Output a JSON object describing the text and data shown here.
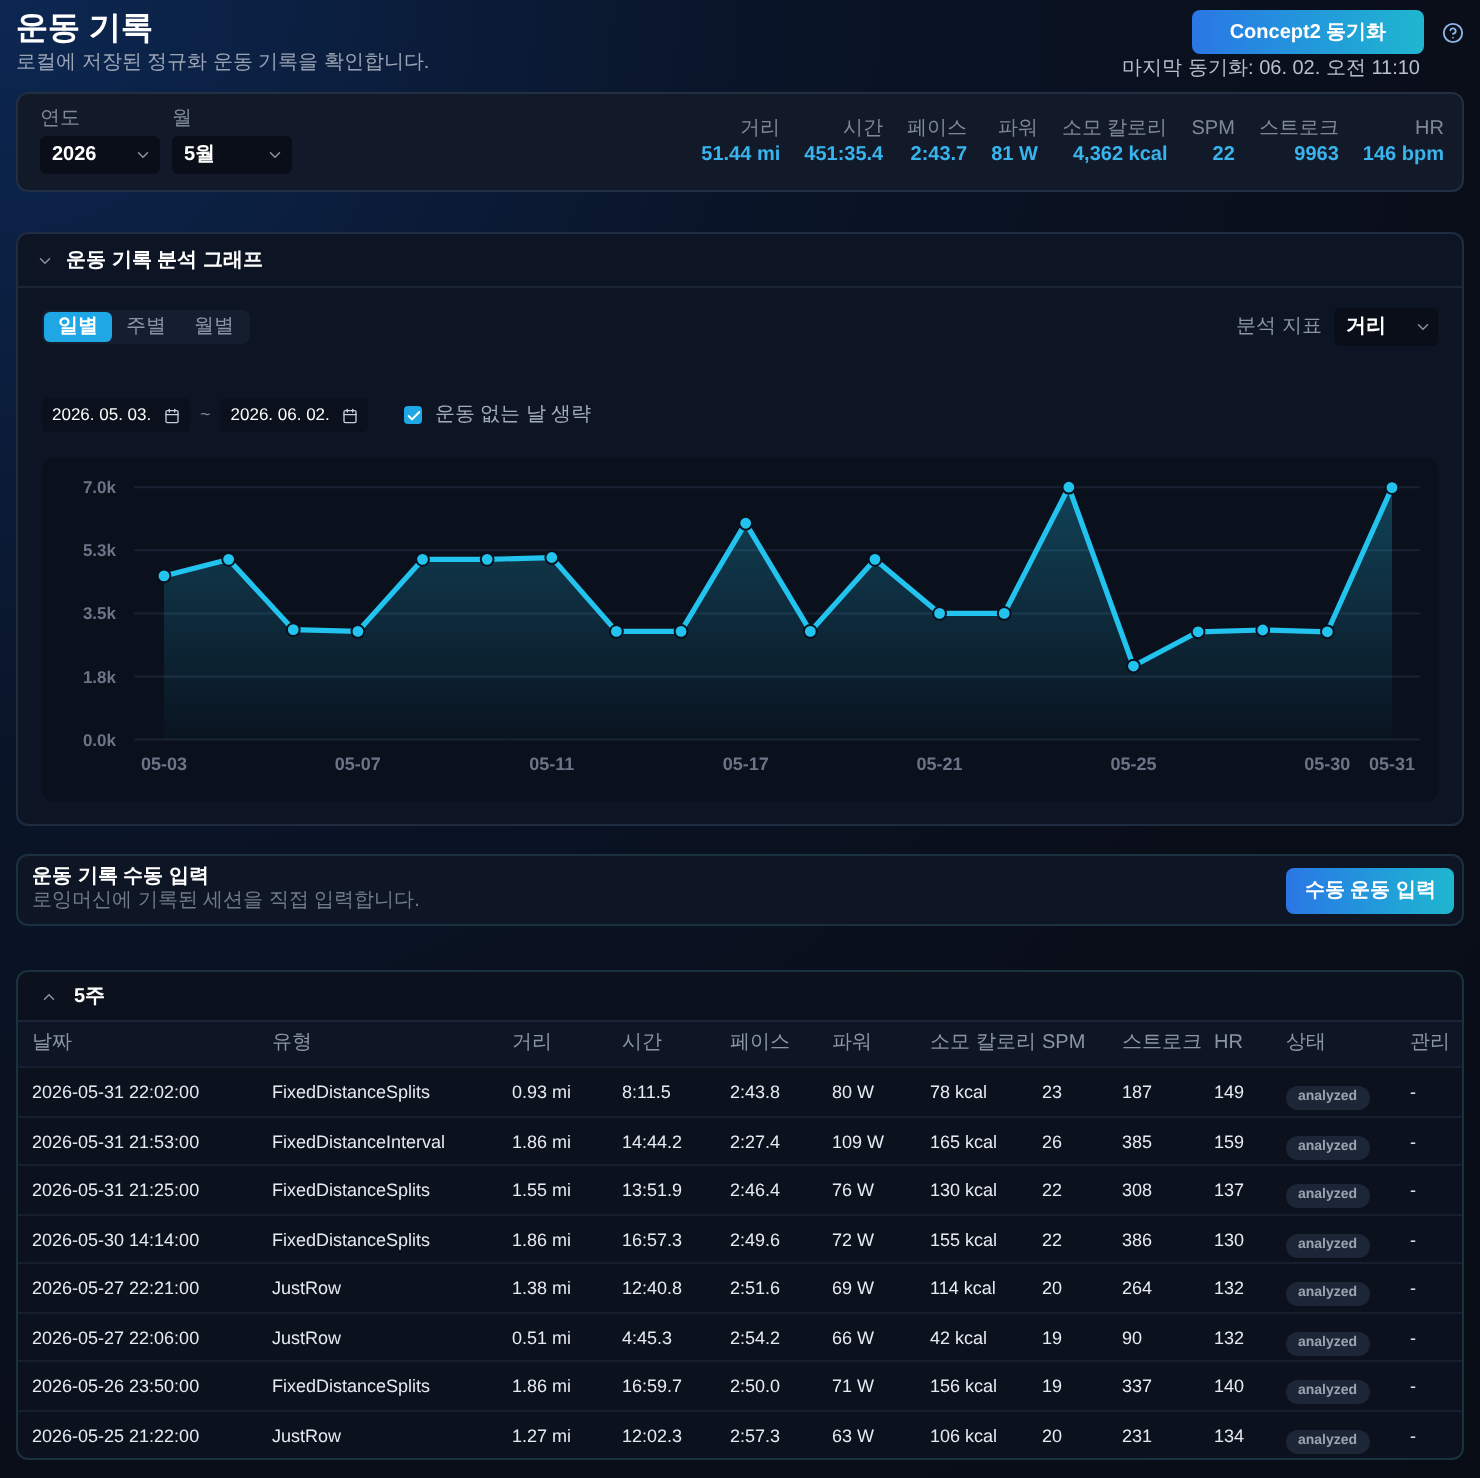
{
  "header": {
    "title": "운동 기록",
    "subtitle": "로컬에 저장된 정규화 운동 기록을 확인합니다.",
    "sync_button": "Concept2 동기화",
    "last_sync": "마지막 동기화: 06. 02. 오전 11:10"
  },
  "filters": {
    "fields": [
      {
        "label": "연도",
        "value": "2026"
      },
      {
        "label": "월",
        "value": "5월"
      }
    ],
    "stats": [
      {
        "label": "거리",
        "value": "51.44 mi"
      },
      {
        "label": "시간",
        "value": "451:35.4"
      },
      {
        "label": "페이스",
        "value": "2:43.7"
      },
      {
        "label": "파워",
        "value": "81 W"
      },
      {
        "label": "소모 칼로리",
        "value": "4,362 kcal"
      },
      {
        "label": "SPM",
        "value": "22"
      },
      {
        "label": "스트로크",
        "value": "9963"
      },
      {
        "label": "HR",
        "value": "146 bpm"
      }
    ]
  },
  "chart_panel": {
    "title": "운동 기록 분석 그래프",
    "periods": [
      {
        "label": "일별",
        "selected": true
      },
      {
        "label": "주별",
        "selected": false
      },
      {
        "label": "월별",
        "selected": false
      }
    ],
    "metric": {
      "label": "분석 지표",
      "value": "거리"
    },
    "date_from": "2026. 05. 03.",
    "date_separator": "~",
    "date_to": "2026. 06. 02.",
    "skip_empty": {
      "label": "운동 없는 날 생략",
      "checked": true
    },
    "chart_data": {
      "type": "area",
      "grid": true,
      "categories": [
        "05-03",
        null,
        null,
        "05-07",
        null,
        null,
        "05-11",
        null,
        null,
        "05-17",
        null,
        null,
        "05-21",
        null,
        null,
        "05-25",
        null,
        null,
        "05-30",
        "05-31"
      ],
      "ylim": [
        0,
        7000
      ],
      "yticks": [
        {
          "value": 0,
          "label": "0.0k"
        },
        {
          "value": 1750,
          "label": "1.8k"
        },
        {
          "value": 3500,
          "label": "3.5k"
        },
        {
          "value": 5250,
          "label": "5.3k"
        },
        {
          "value": 7000,
          "label": "7.0k"
        }
      ],
      "series": [
        {
          "color": "#22c3ee",
          "marker": "circle",
          "values": [
            4540,
            5000,
            3050,
            3000,
            5000,
            5000,
            5050,
            3000,
            3000,
            6000,
            3000,
            5000,
            3500,
            3500,
            7000,
            2040,
            2990,
            3040,
            2990,
            6990
          ]
        }
      ]
    }
  },
  "manual_entry": {
    "title": "운동 기록 수동 입력",
    "subtitle": "로잉머신에 기록된 세션을 직접 입력합니다.",
    "button": "수동 운동 입력"
  },
  "week_table": {
    "title": "5주",
    "columns": [
      {
        "label": "날짜",
        "kind": "text"
      },
      {
        "label": "유형",
        "kind": "text"
      },
      {
        "label": "거리",
        "kind": "text"
      },
      {
        "label": "시간",
        "kind": "text"
      },
      {
        "label": "페이스",
        "kind": "text"
      },
      {
        "label": "파워",
        "kind": "text"
      },
      {
        "label": "소모 칼로리",
        "kind": "text"
      },
      {
        "label": "SPM",
        "kind": "text"
      },
      {
        "label": "스트로크",
        "kind": "text"
      },
      {
        "label": "HR",
        "kind": "text"
      },
      {
        "label": "상태",
        "kind": "badge"
      },
      {
        "label": "관리",
        "kind": "text"
      }
    ],
    "rows": [
      [
        "2026-05-31 22:02:00",
        "FixedDistanceSplits",
        "0.93 mi",
        "8:11.5",
        "2:43.8",
        "80 W",
        "78 kcal",
        "23",
        "187",
        "149",
        "analyzed",
        "-"
      ],
      [
        "2026-05-31 21:53:00",
        "FixedDistanceInterval",
        "1.86 mi",
        "14:44.2",
        "2:27.4",
        "109 W",
        "165 kcal",
        "26",
        "385",
        "159",
        "analyzed",
        "-"
      ],
      [
        "2026-05-31 21:25:00",
        "FixedDistanceSplits",
        "1.55 mi",
        "13:51.9",
        "2:46.4",
        "76 W",
        "130 kcal",
        "22",
        "308",
        "137",
        "analyzed",
        "-"
      ],
      [
        "2026-05-30 14:14:00",
        "FixedDistanceSplits",
        "1.86 mi",
        "16:57.3",
        "2:49.6",
        "72 W",
        "155 kcal",
        "22",
        "386",
        "130",
        "analyzed",
        "-"
      ],
      [
        "2026-05-27 22:21:00",
        "JustRow",
        "1.38 mi",
        "12:40.8",
        "2:51.6",
        "69 W",
        "114 kcal",
        "20",
        "264",
        "132",
        "analyzed",
        "-"
      ],
      [
        "2026-05-27 22:06:00",
        "JustRow",
        "0.51 mi",
        "4:45.3",
        "2:54.2",
        "66 W",
        "42 kcal",
        "19",
        "90",
        "132",
        "analyzed",
        "-"
      ],
      [
        "2026-05-26 23:50:00",
        "FixedDistanceSplits",
        "1.86 mi",
        "16:59.7",
        "2:50.0",
        "71 W",
        "156 kcal",
        "19",
        "337",
        "140",
        "analyzed",
        "-"
      ],
      [
        "2026-05-25 21:22:00",
        "JustRow",
        "1.27 mi",
        "12:02.3",
        "2:57.3",
        "63 W",
        "106 kcal",
        "20",
        "231",
        "134",
        "analyzed",
        "-"
      ]
    ]
  }
}
